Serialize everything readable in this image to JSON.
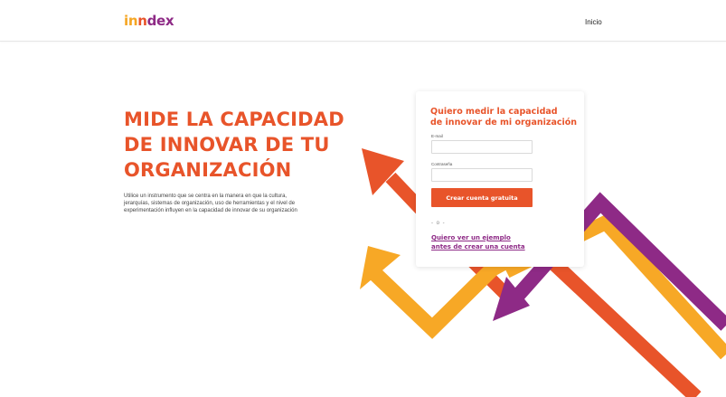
{
  "header": {
    "logo": {
      "part1": "in",
      "part2": "n",
      "part3": "dex"
    },
    "nav_home": "Inicio"
  },
  "hero": {
    "title_line1": "MIDE LA CAPACIDAD",
    "title_line2": "DE INNOVAR DE TU",
    "title_line3": "ORGANIZACIÓN",
    "description": "Utilice un instrumento que se centra en la manera en que la cultura, jerarquías, sistemas de organización, uso de herramientas y el nivel de experimentación influyen en la capacidad de innovar de su organización"
  },
  "signup_card": {
    "title_line1": "Quiero medir la capacidad",
    "title_line2": "de innovar de mi organización",
    "email_label": "E-mail",
    "email_value": "",
    "password_label": "Contraseña",
    "password_value": "",
    "submit_label": "Crear cuenta gratuita",
    "separator": "- o -",
    "example_link_line1": "Quiero ver un ejemplo",
    "example_link_line2": "antes de crear una cuenta"
  },
  "colors": {
    "brand_orange": "#e8542a",
    "brand_yellow": "#f5a623",
    "brand_purple": "#8e2a86"
  },
  "decor": {
    "arrow_icons": [
      "arrow-orange-icon",
      "arrow-yellow-icon",
      "arrow-purple-icon"
    ]
  }
}
